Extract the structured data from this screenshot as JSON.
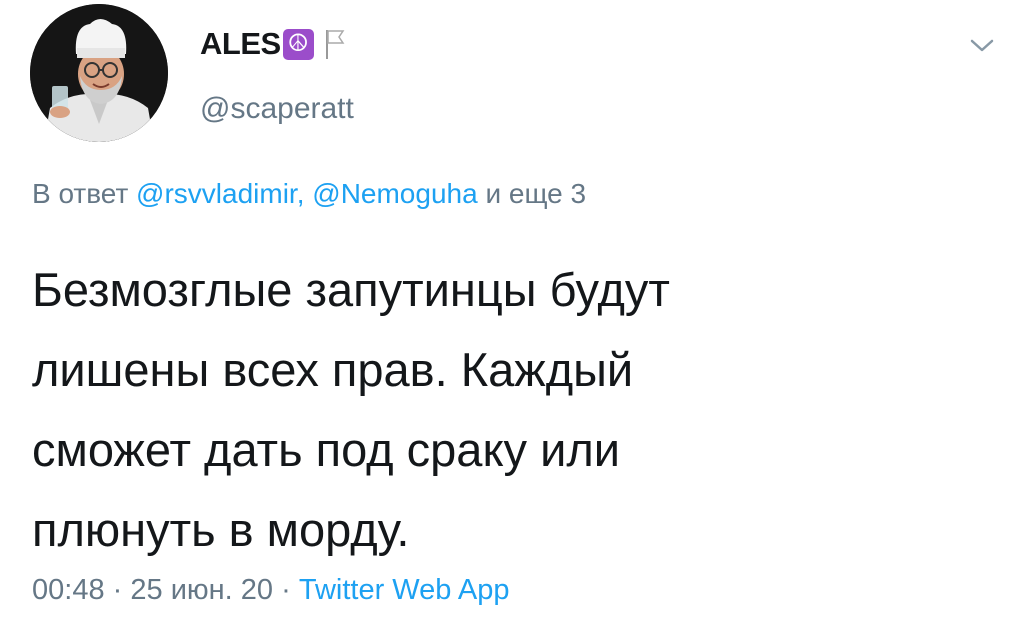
{
  "author": {
    "display_name": "ALES",
    "badge_emoji": "☮",
    "handle": "@scaperatt",
    "badge_color": "#9b4dca"
  },
  "reply_to": {
    "prefix": "В ответ",
    "mention_1": "@rsvvladimir,",
    "mention_2": "@Nemoguha",
    "suffix": "и еще 3"
  },
  "tweet": {
    "lines": [
      "Безмозглые запутинцы будут",
      "лишены всех прав. Каждый",
      "сможет дать под сраку или",
      "плюнуть в морду."
    ]
  },
  "meta": {
    "time": "00:48",
    "sep_1": "·",
    "date": "25 июн. 20",
    "sep_2": "·",
    "source": "Twitter Web App"
  },
  "colors": {
    "text": "#14171a",
    "secondary": "#657786",
    "link": "#1da1f2"
  },
  "icons": {
    "flag": "white-flag-icon",
    "menu": "chevron-down-icon"
  }
}
